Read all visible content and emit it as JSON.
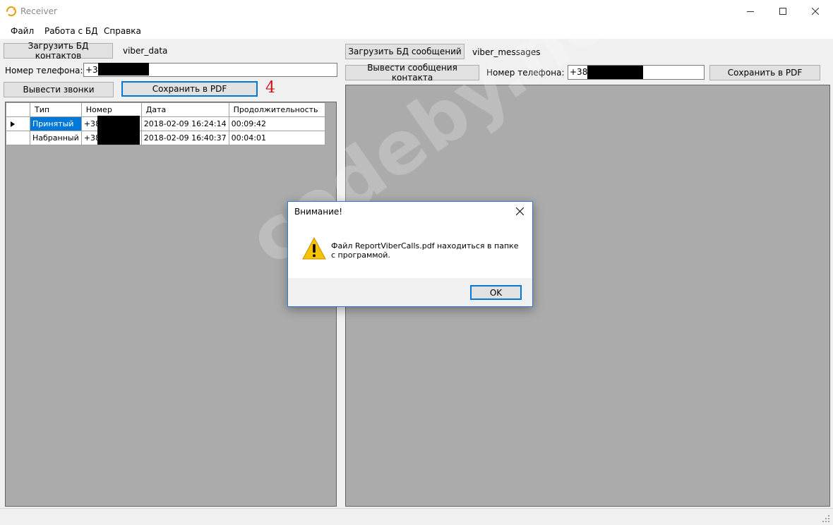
{
  "window": {
    "title": "Receiver",
    "icon": "receiver-app-icon",
    "controls": [
      "minimize-icon",
      "maximize-icon",
      "close-icon"
    ]
  },
  "menu": {
    "items": [
      "Файл",
      "Работа с БД",
      "Справка"
    ]
  },
  "left": {
    "load_button": "Загрузить БД контактов",
    "db_name": "viber_data",
    "phone_label": "Номер телефона:",
    "phone_value": "+38",
    "calls_button": "Вывести звонки",
    "pdf_button": "Сохранить в PDF",
    "annotation": "4",
    "table": {
      "columns": [
        "Тип",
        "Номер",
        "Дата",
        "Продолжительность"
      ],
      "rows": [
        {
          "type": "Принятый",
          "number": "+38",
          "date": "2018-02-09 16:24:14",
          "duration": "00:09:42",
          "current": true
        },
        {
          "type": "Набранный",
          "number": "+38",
          "date": "2018-02-09 16:40:37",
          "duration": "00:04:01",
          "current": false
        }
      ]
    }
  },
  "right": {
    "load_button": "Загрузить БД сообщений",
    "db_name": "viber_messages",
    "messages_button": "Вывести сообщения контакта",
    "phone_label": "Номер телефона:",
    "phone_value": "+380",
    "pdf_button": "Сохранить в PDF"
  },
  "dialog": {
    "title": "Внимание!",
    "message": "Файл ReportViberCalls.pdf находиться в папке с программой.",
    "ok_button": "OK",
    "icon": "warning-icon"
  },
  "watermark": "codeby.net",
  "colors": {
    "selection": "#0078d7",
    "panel": "#ababab",
    "annotation": "#d01010",
    "warning": "#f5c400"
  }
}
